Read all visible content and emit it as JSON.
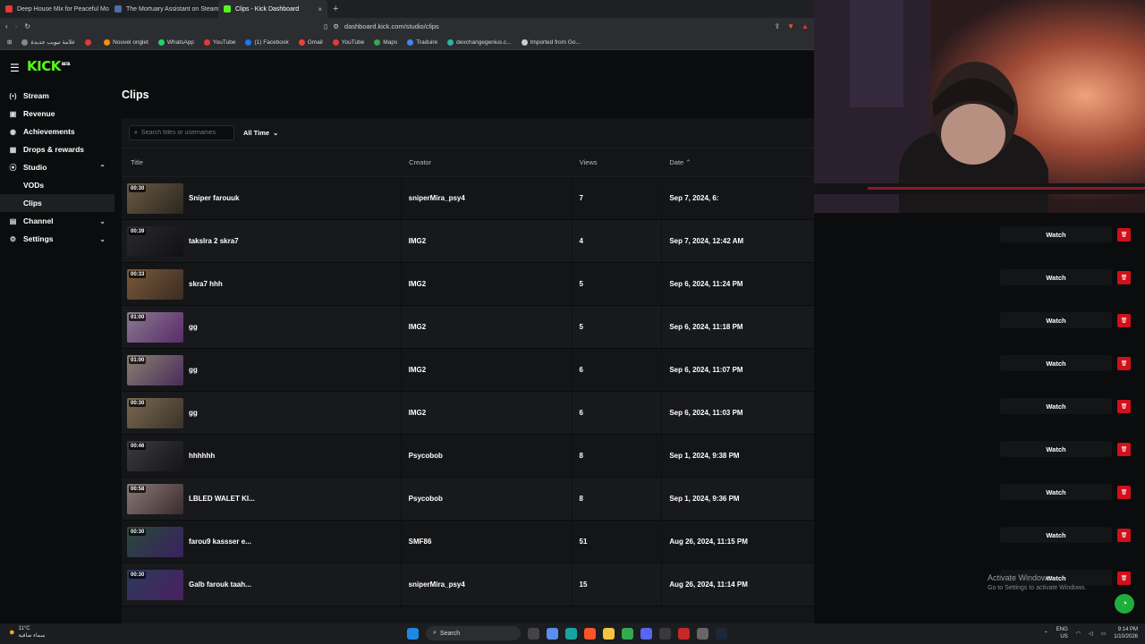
{
  "browser": {
    "tabs": [
      {
        "label": "Deep House Mix for Peaceful Mornin",
        "color": "#e53935"
      },
      {
        "label": "The Mortuary Assistant on Steam",
        "color": "#4a6fa5"
      },
      {
        "label": "Clips - Kick Dashboard",
        "color": "#53fc18"
      }
    ],
    "url": "dashboard.kick.com/studio/clips",
    "bookmarks": [
      {
        "label": "علامة تبويب جديدة",
        "color": "#888"
      },
      {
        "label": "",
        "color": "#e53935"
      },
      {
        "label": "Nouvel onglet",
        "color": "#ff8c00"
      },
      {
        "label": "WhatsApp",
        "color": "#25d366"
      },
      {
        "label": "YouTube",
        "color": "#e53935"
      },
      {
        "label": "(1) Facebook",
        "color": "#1877f2"
      },
      {
        "label": "Gmail",
        "color": "#ea4335"
      },
      {
        "label": "YouTube",
        "color": "#e53935"
      },
      {
        "label": "Maps",
        "color": "#34a853"
      },
      {
        "label": "Traduire",
        "color": "#4285f4"
      },
      {
        "label": "dexchangegenius.c...",
        "color": "#2bb5a0"
      },
      {
        "label": "Imported from Go...",
        "color": "#cccccc"
      }
    ]
  },
  "sidebar": {
    "logo": "KICK",
    "logo_badge": "BETA",
    "items": [
      {
        "label": "Stream",
        "icon": "(•)",
        "sub": false,
        "chev": ""
      },
      {
        "label": "Revenue",
        "icon": "▣",
        "sub": false,
        "chev": ""
      },
      {
        "label": "Achievements",
        "icon": "◉",
        "sub": false,
        "chev": ""
      },
      {
        "label": "Drops & rewards",
        "icon": "▦",
        "sub": false,
        "chev": ""
      },
      {
        "label": "Studio",
        "icon": "⦿",
        "sub": false,
        "chev": "⌃"
      },
      {
        "label": "VODs",
        "icon": "",
        "sub": true,
        "chev": ""
      },
      {
        "label": "Clips",
        "icon": "",
        "sub": true,
        "chev": "",
        "active": true
      },
      {
        "label": "Channel",
        "icon": "▤",
        "sub": false,
        "chev": "⌄"
      },
      {
        "label": "Settings",
        "icon": "⚙",
        "sub": false,
        "chev": "⌄"
      }
    ]
  },
  "main": {
    "title": "Clips",
    "search_placeholder": "Search titles or usernames",
    "time_filter": "All Time",
    "columns": {
      "title": "Title",
      "creator": "Creator",
      "views": "Views",
      "date": "Date"
    },
    "rows": [
      {
        "duration": "00:30",
        "title": "Sniper farouuk",
        "creator": "sniperMira_psy4",
        "views": "7",
        "date": "Sep 7, 2024, 6:",
        "c1": "#6b5a44",
        "c2": "#2b2620"
      },
      {
        "duration": "00:39",
        "title": "takslra 2 skra7",
        "creator": "IMG2",
        "views": "4",
        "date": "Sep 7, 2024, 12:42 AM",
        "c1": "#2a2a2e",
        "c2": "#111113"
      },
      {
        "duration": "00:33",
        "title": "skra7 hhh",
        "creator": "IMG2",
        "views": "5",
        "date": "Sep 6, 2024, 11:24 PM",
        "c1": "#7a5a3c",
        "c2": "#3a2b22"
      },
      {
        "duration": "01:00",
        "title": "gg",
        "creator": "IMG2",
        "views": "5",
        "date": "Sep 6, 2024, 11:18 PM",
        "c1": "#8a7a90",
        "c2": "#5a2a6a"
      },
      {
        "duration": "01:00",
        "title": "gg",
        "creator": "IMG2",
        "views": "6",
        "date": "Sep 6, 2024, 11:07 PM",
        "c1": "#8a8272",
        "c2": "#4a2a5a"
      },
      {
        "duration": "00:30",
        "title": "gg",
        "creator": "IMG2",
        "views": "6",
        "date": "Sep 6, 2024, 11:03 PM",
        "c1": "#7a6a52",
        "c2": "#3a3228"
      },
      {
        "duration": "00:46",
        "title": "hhhhhh",
        "creator": "Psycobob",
        "views": "8",
        "date": "Sep 1, 2024, 9:38 PM",
        "c1": "#3a3a40",
        "c2": "#151518"
      },
      {
        "duration": "00:58",
        "title": "LBLED WALET KI...",
        "creator": "Psycobob",
        "views": "8",
        "date": "Sep 1, 2024, 9:36 PM",
        "c1": "#8a7a78",
        "c2": "#3a2a2a"
      },
      {
        "duration": "00:30",
        "title": "farou9 kassser e...",
        "creator": "SMF86",
        "views": "51",
        "date": "Aug 26, 2024, 11:15 PM",
        "c1": "#2a4a3a",
        "c2": "#3a2060"
      },
      {
        "duration": "00:30",
        "title": "Galb farouk taah...",
        "creator": "sniperMira_psy4",
        "views": "15",
        "date": "Aug 26, 2024, 11:14 PM",
        "c1": "#2a3a5a",
        "c2": "#4a2060"
      }
    ],
    "watch_label": "Watch"
  },
  "overlay": {
    "activate_title": "Activate Windows",
    "activate_sub": "Go to Settings to activate Windows."
  },
  "taskbar": {
    "weather_temp": "11°C",
    "weather_desc": "سماء صافية",
    "search": "Search",
    "lang1": "ENG",
    "lang2": "US",
    "time": "9:14 PM",
    "date": "1/10/2026"
  }
}
